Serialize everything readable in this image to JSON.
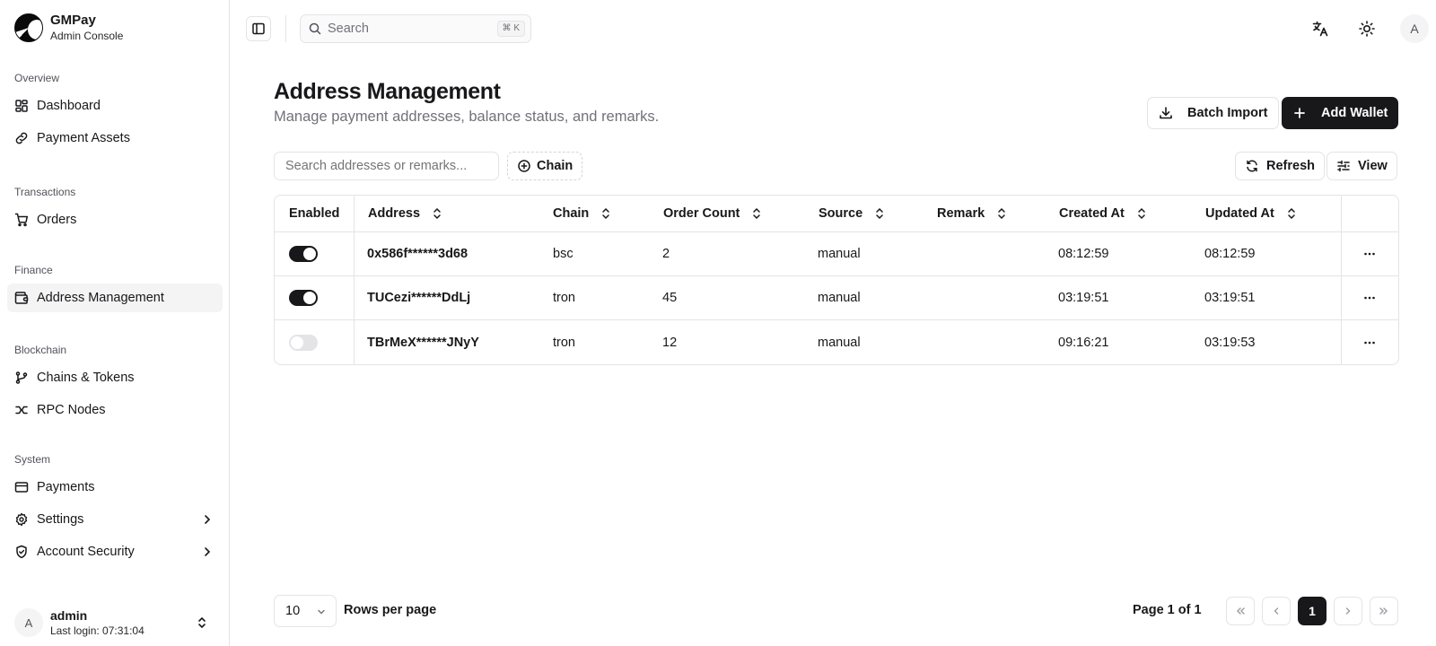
{
  "brand": {
    "name": "GMPay",
    "subtitle": "Admin Console"
  },
  "sidebar": {
    "groups": [
      {
        "label": "Overview",
        "items": [
          {
            "label": "Dashboard",
            "icon": "dashboard-icon"
          },
          {
            "label": "Payment Assets",
            "icon": "link-icon"
          }
        ]
      },
      {
        "label": "Transactions",
        "items": [
          {
            "label": "Orders",
            "icon": "cart-icon"
          }
        ]
      },
      {
        "label": "Finance",
        "items": [
          {
            "label": "Address Management",
            "icon": "wallet-icon",
            "active": true
          }
        ]
      },
      {
        "label": "Blockchain",
        "items": [
          {
            "label": "Chains & Tokens",
            "icon": "git-branch-icon"
          },
          {
            "label": "RPC Nodes",
            "icon": "cable-icon"
          }
        ]
      },
      {
        "label": "System",
        "items": [
          {
            "label": "Payments",
            "icon": "credit-card-icon"
          },
          {
            "label": "Settings",
            "icon": "gear-icon",
            "chevron": true
          },
          {
            "label": "Account Security",
            "icon": "shield-check-icon",
            "chevron": true
          }
        ]
      }
    ]
  },
  "user": {
    "initial": "A",
    "name": "admin",
    "last_login": "Last login: 07:31:04"
  },
  "topbar": {
    "search_label": "Search",
    "search_shortcut": "⌘ K",
    "avatar_initial": "A"
  },
  "page": {
    "title": "Address Management",
    "subtitle": "Manage payment addresses, balance status, and remarks.",
    "batch_import_label": "Batch Import",
    "add_wallet_label": "Add Wallet",
    "filter_placeholder": "Search addresses or remarks...",
    "chain_filter_label": "Chain",
    "refresh_label": "Refresh",
    "view_label": "View"
  },
  "table": {
    "headers": {
      "enabled": "Enabled",
      "address": "Address",
      "chain": "Chain",
      "order_count": "Order Count",
      "source": "Source",
      "remark": "Remark",
      "created_at": "Created At",
      "updated_at": "Updated At"
    },
    "rows": [
      {
        "enabled": true,
        "address": "0x586f******3d68",
        "chain": "bsc",
        "order_count": "2",
        "source": "manual",
        "remark": "",
        "created_at": "08:12:59",
        "updated_at": "08:12:59"
      },
      {
        "enabled": true,
        "address": "TUCezi******DdLj",
        "chain": "tron",
        "order_count": "45",
        "source": "manual",
        "remark": "",
        "created_at": "03:19:51",
        "updated_at": "03:19:51"
      },
      {
        "enabled": false,
        "address": "TBrMeX******JNyY",
        "chain": "tron",
        "order_count": "12",
        "source": "manual",
        "remark": "",
        "created_at": "09:16:21",
        "updated_at": "03:19:53"
      }
    ]
  },
  "pagination": {
    "rows_per_page_value": "10",
    "rows_per_page_label": "Rows per page",
    "page_info": "Page 1 of 1",
    "current_page": "1"
  }
}
